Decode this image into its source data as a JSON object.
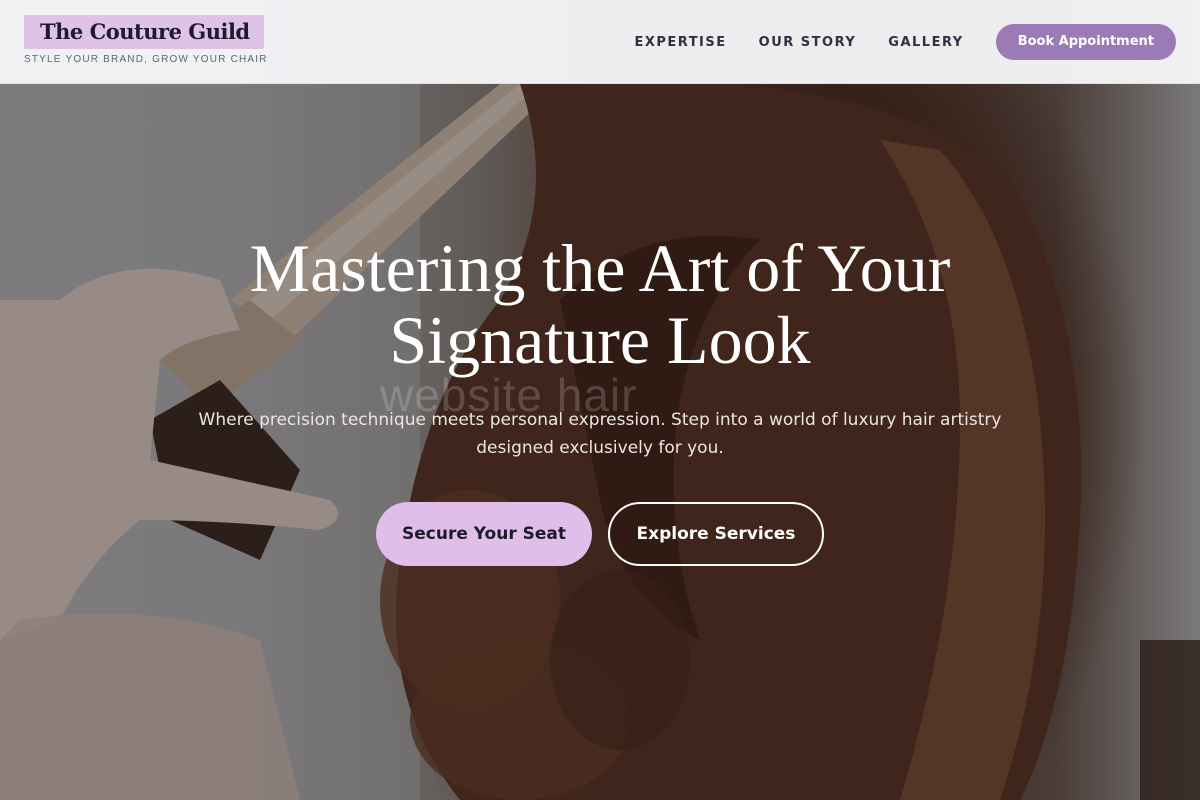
{
  "header": {
    "brand_name": "The Couture Guild",
    "tagline": "STYLE YOUR BRAND, GROW YOUR CHAIR",
    "nav": [
      {
        "label": "EXPERTISE"
      },
      {
        "label": "OUR STORY"
      },
      {
        "label": "GALLERY"
      }
    ],
    "cta_label": "Book Appointment"
  },
  "hero": {
    "headline": "Mastering the Art of Your Signature Look",
    "subtext": "Where precision technique meets personal expression. Step into a world of luxury hair artistry designed exclusively for you.",
    "watermark": "website hair",
    "primary_cta": "Secure Your Seat",
    "secondary_cta": "Explore Services",
    "background_image": "hair-styling-photo"
  },
  "colors": {
    "brand_highlight": "#dfc3e6",
    "nav_cta": "#9a7bb6",
    "primary_cta": "#e1bde9",
    "text_dark": "#2e3142"
  }
}
